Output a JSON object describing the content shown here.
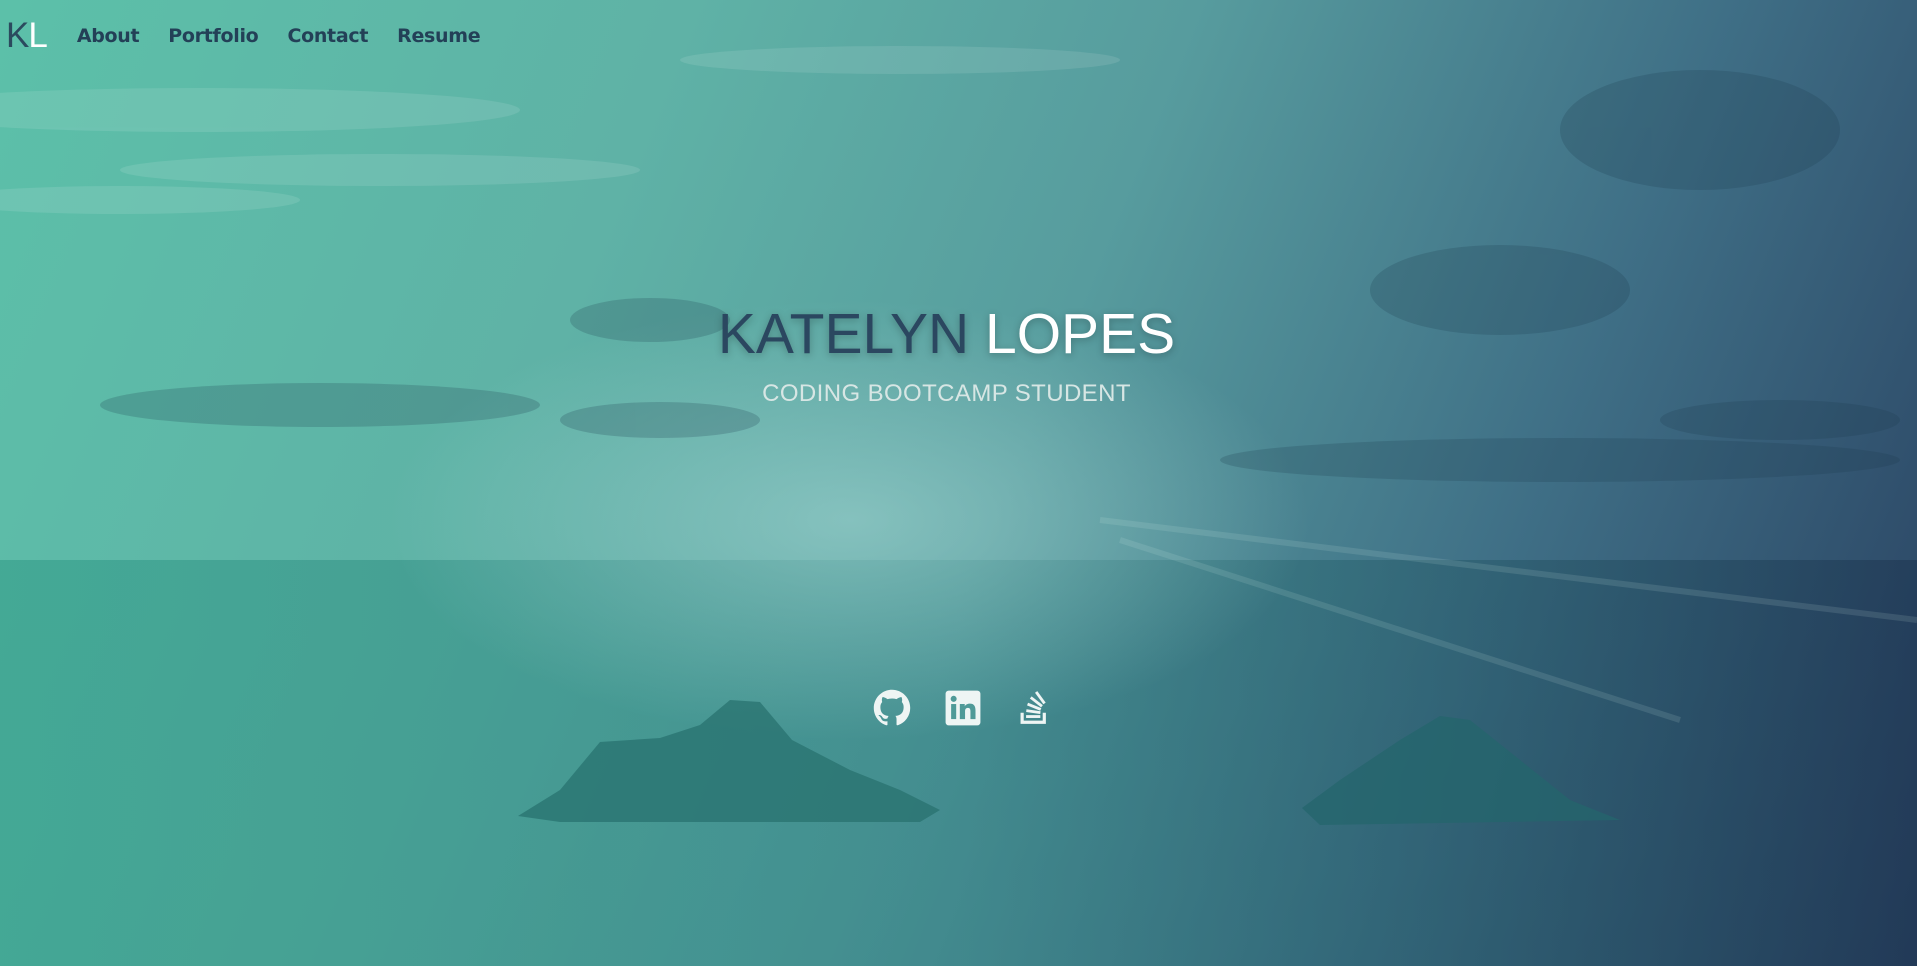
{
  "brand": {
    "initial_first": "K",
    "initial_last": "L"
  },
  "nav": {
    "items": [
      {
        "label": "About"
      },
      {
        "label": "Portfolio"
      },
      {
        "label": "Contact"
      },
      {
        "label": "Resume"
      }
    ]
  },
  "hero": {
    "first_name": "KATELYN",
    "last_name": "LOPES",
    "subtitle": "CODING BOOTCAMP STUDENT"
  },
  "socials": {
    "items": [
      {
        "icon": "github-icon"
      },
      {
        "icon": "linkedin-icon"
      },
      {
        "icon": "stack-overflow-icon"
      }
    ]
  },
  "colors": {
    "navy_text": "#234057",
    "white_text": "#ffffff",
    "teal_light": "#5cc0a9",
    "navy_dark": "#283f5f"
  }
}
